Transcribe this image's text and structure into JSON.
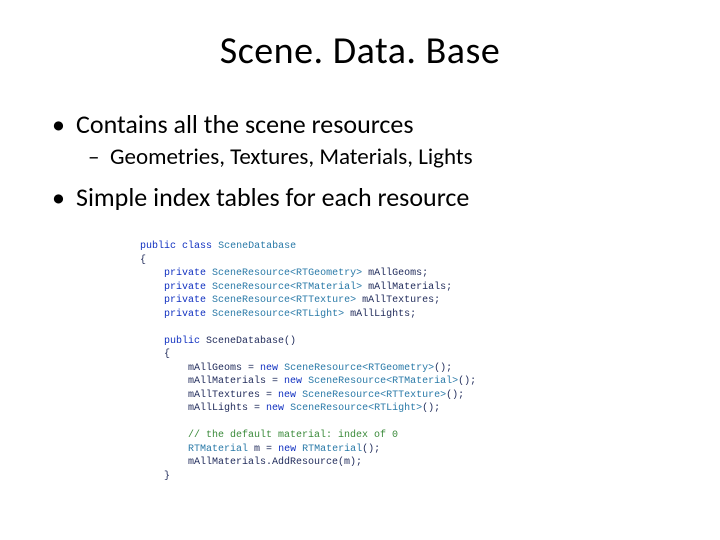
{
  "title": "Scene. Data. Base",
  "bullets": [
    {
      "text": "Contains all the scene resources",
      "sub": [
        "Geometries, Textures, Materials, Lights"
      ]
    },
    {
      "text": "Simple index tables for each resource"
    }
  ],
  "code": {
    "l0a": "public",
    "l0b": "class",
    "l0c": "SceneDatabase",
    "l1": "{",
    "brace_close": "}",
    "kw_private": "private",
    "kw_public": "public",
    "kw_new": "new",
    "t_geom": "SceneResource<RTGeometry>",
    "t_mat": "SceneResource<RTMaterial>",
    "t_tex": "SceneResource<RTTexture>",
    "t_light": "SceneResource<RTLight>",
    "t_rtmat": "RTMaterial",
    "f_geoms": "mAllGeoms;",
    "f_mats": "mAllMaterials;",
    "f_texs": "mAllTextures;",
    "f_lights": "mAllLights;",
    "ctor": "SceneDatabase()",
    "a_geoms_l": "mAllGeoms =",
    "a_mats_l": "mAllMaterials =",
    "a_texs_l": "mAllTextures =",
    "a_lights_l": "mAllLights =",
    "ctor_tail": "();",
    "cmt": "// the default material: index of 0",
    "m_decl": "m =",
    "addres": "mAllMaterials.AddResource(m);"
  }
}
